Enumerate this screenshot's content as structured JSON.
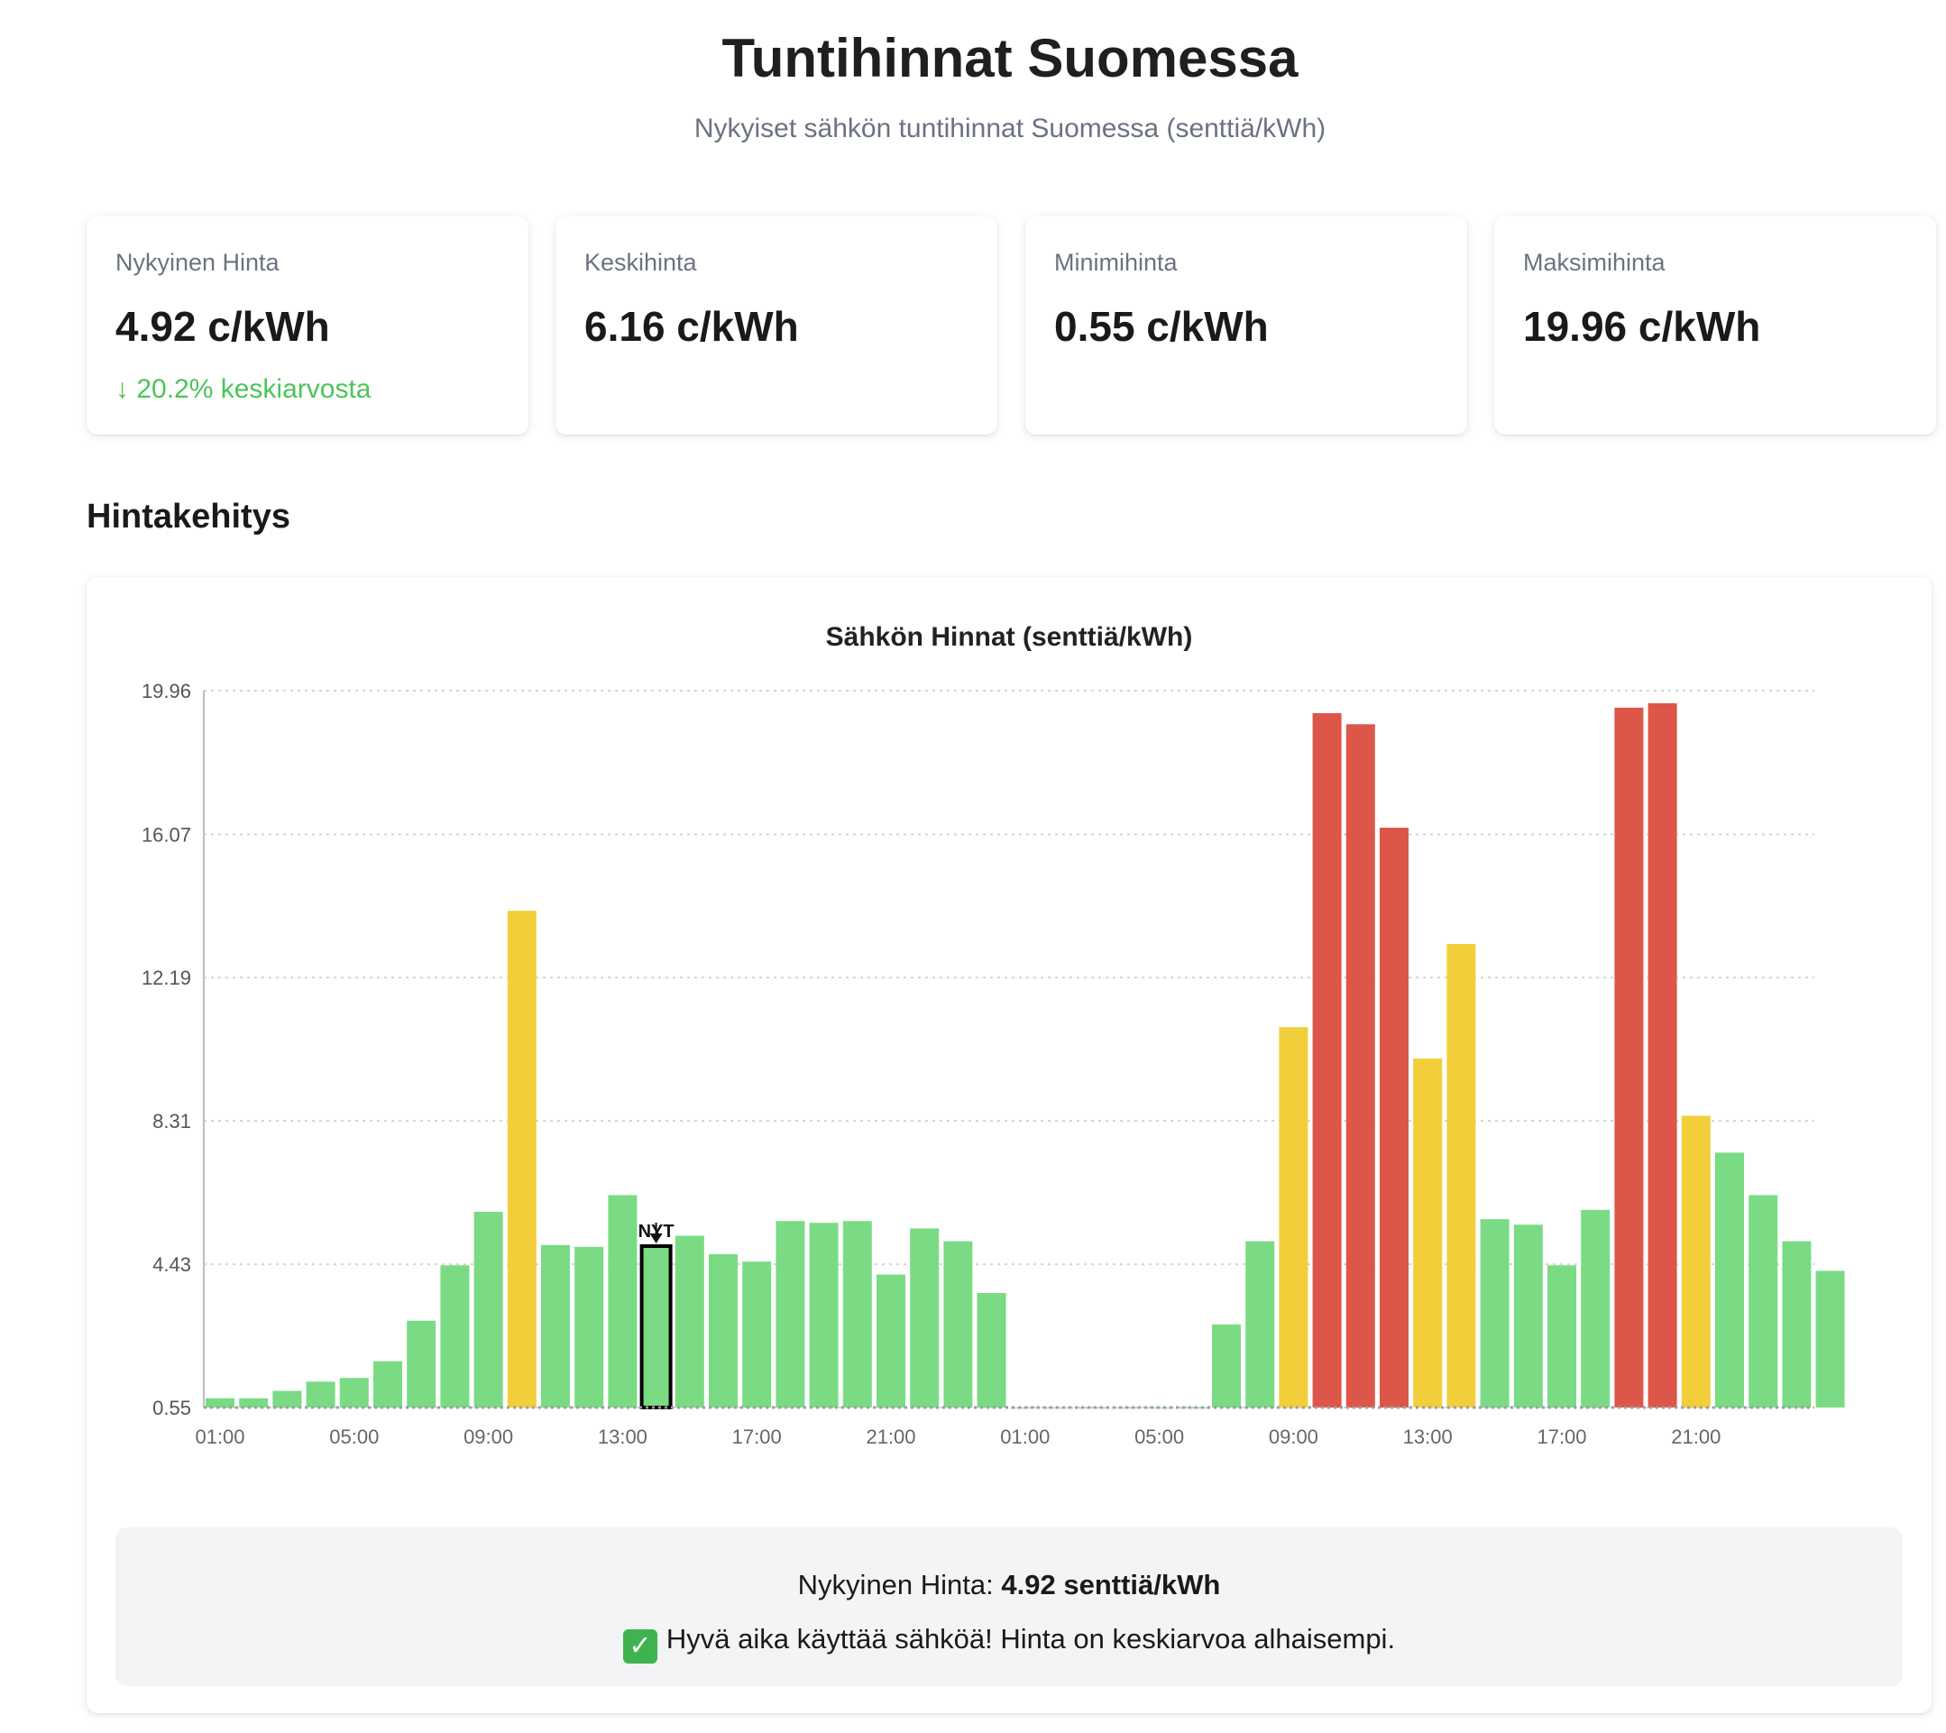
{
  "header": {
    "title": "Tuntihinnat Suomessa",
    "subtitle": "Nykyiset sähkön tuntihinnat Suomessa (senttiä/kWh)"
  },
  "stats": [
    {
      "label": "Nykyinen Hinta",
      "value": "4.92 c/kWh",
      "note": "↓ 20.2% keskiarvosta"
    },
    {
      "label": "Keskihinta",
      "value": "6.16 c/kWh"
    },
    {
      "label": "Minimihinta",
      "value": "0.55 c/kWh"
    },
    {
      "label": "Maksimihinta",
      "value": "19.96 c/kWh"
    }
  ],
  "section": {
    "title": "Hintakehitys"
  },
  "colors": {
    "low": "#7adb84",
    "mid": "#f2cf3a",
    "high": "#dd564a",
    "now_outline": "#000000"
  },
  "chart_data": {
    "type": "bar",
    "title": "Sähkön Hinnat (senttiä/kWh)",
    "ylim": [
      0.55,
      19.96
    ],
    "yticks": [
      "19.96",
      "16.07",
      "12.19",
      "8.31",
      "4.43",
      "0.55"
    ],
    "ytick_values": [
      19.96,
      16.07,
      12.19,
      8.31,
      4.43,
      0.55
    ],
    "xtick_labels": [
      "01:00",
      "05:00",
      "09:00",
      "13:00",
      "17:00",
      "21:00",
      "01:00",
      "05:00",
      "09:00",
      "13:00",
      "17:00",
      "21:00"
    ],
    "grid": true,
    "now_label": "NYT",
    "now_index": 13,
    "values": [
      0.8,
      0.8,
      1.0,
      1.25,
      1.35,
      1.8,
      2.9,
      4.4,
      5.85,
      14.0,
      4.95,
      4.9,
      6.3,
      4.92,
      5.2,
      4.7,
      4.5,
      5.6,
      5.55,
      5.6,
      4.15,
      5.4,
      5.05,
      3.65,
      0.55,
      0.55,
      0.55,
      0.55,
      0.55,
      0.55,
      2.8,
      5.05,
      10.85,
      19.35,
      19.05,
      16.25,
      10.0,
      13.1,
      5.65,
      5.5,
      4.4,
      5.9,
      19.5,
      19.62,
      8.45,
      7.45,
      6.3,
      5.05,
      4.25
    ],
    "categories": [
      "mid",
      "mid",
      "mid",
      "mid",
      "mid",
      "mid",
      "mid",
      "mid",
      "mid",
      "mid",
      "mid",
      "mid",
      "mid",
      "mid",
      "mid",
      "mid",
      "mid",
      "mid",
      "mid",
      "mid",
      "mid",
      "mid",
      "mid",
      "mid",
      "mid",
      "mid",
      "mid",
      "mid",
      "mid",
      "mid",
      "mid",
      "mid",
      "mid",
      "mid",
      "mid",
      "mid",
      "mid",
      "mid",
      "mid",
      "mid",
      "mid",
      "mid",
      "mid",
      "mid",
      "mid",
      "mid",
      "mid",
      "mid",
      "mid"
    ],
    "levels": [
      "low",
      "low",
      "low",
      "low",
      "low",
      "low",
      "low",
      "low",
      "low",
      "mid",
      "low",
      "low",
      "low",
      "low",
      "low",
      "low",
      "low",
      "low",
      "low",
      "low",
      "low",
      "low",
      "low",
      "low",
      "low",
      "low",
      "low",
      "low",
      "low",
      "low",
      "low",
      "low",
      "mid",
      "high",
      "high",
      "high",
      "mid",
      "mid",
      "low",
      "low",
      "low",
      "low",
      "high",
      "high",
      "mid",
      "low",
      "low",
      "low",
      "low"
    ]
  },
  "info": {
    "current_label": "Nykyinen Hinta: ",
    "current_value": "4.92 senttiä/kWh",
    "message": "Hyvä aika käyttää sähköä! Hinta on keskiarvoa alhaisempi."
  }
}
